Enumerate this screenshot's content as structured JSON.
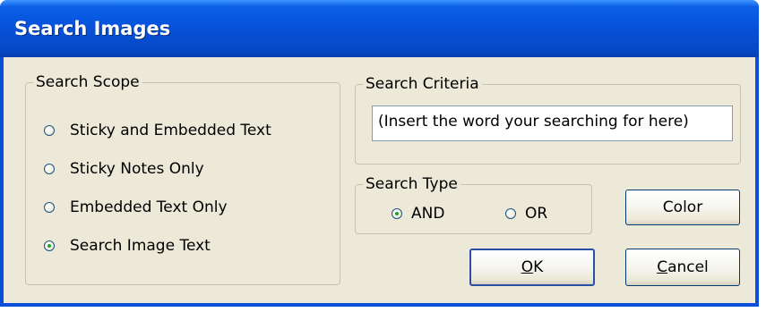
{
  "window": {
    "title": "Search Images"
  },
  "search_scope": {
    "label": "Search Scope",
    "options": [
      {
        "label": "Sticky and Embedded Text",
        "checked": false
      },
      {
        "label": "Sticky Notes Only",
        "checked": false
      },
      {
        "label": "Embedded Text Only",
        "checked": false
      },
      {
        "label": "Search Image Text",
        "checked": true
      }
    ]
  },
  "search_criteria": {
    "label": "Search Criteria",
    "value": "(Insert the word your searching for here)"
  },
  "search_type": {
    "label": "Search Type",
    "options": [
      {
        "label": "AND",
        "checked": true
      },
      {
        "label": "OR",
        "checked": false
      }
    ]
  },
  "buttons": {
    "color": "Color",
    "ok_mnemonic": "O",
    "ok_rest": "K",
    "cancel_mnemonic": "C",
    "cancel_rest": "ancel"
  }
}
